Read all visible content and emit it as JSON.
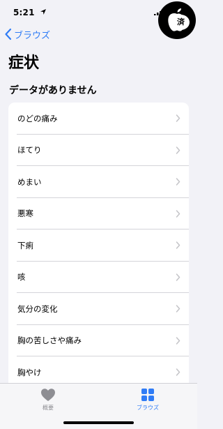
{
  "status_bar": {
    "time": "5:21"
  },
  "watermark": {
    "text": "済"
  },
  "nav": {
    "back_label": "ブラウズ"
  },
  "page": {
    "title": "症状",
    "section_heading": "データがありません"
  },
  "symptoms": [
    {
      "label": "のどの痛み"
    },
    {
      "label": "ほてり"
    },
    {
      "label": "めまい"
    },
    {
      "label": "悪寒"
    },
    {
      "label": "下痢"
    },
    {
      "label": "咳"
    },
    {
      "label": "気分の変化"
    },
    {
      "label": "胸の苦しさや痛み"
    },
    {
      "label": "胸やけ"
    }
  ],
  "tab_bar": {
    "tabs": [
      {
        "label": "概要",
        "icon": "heart-icon",
        "selected": false
      },
      {
        "label": "ブラウズ",
        "icon": "grid-icon",
        "selected": true
      }
    ]
  },
  "colors": {
    "accent": "#2f7cf6",
    "background": "#f2f2f7",
    "inactive_tab": "#8e8e93"
  }
}
